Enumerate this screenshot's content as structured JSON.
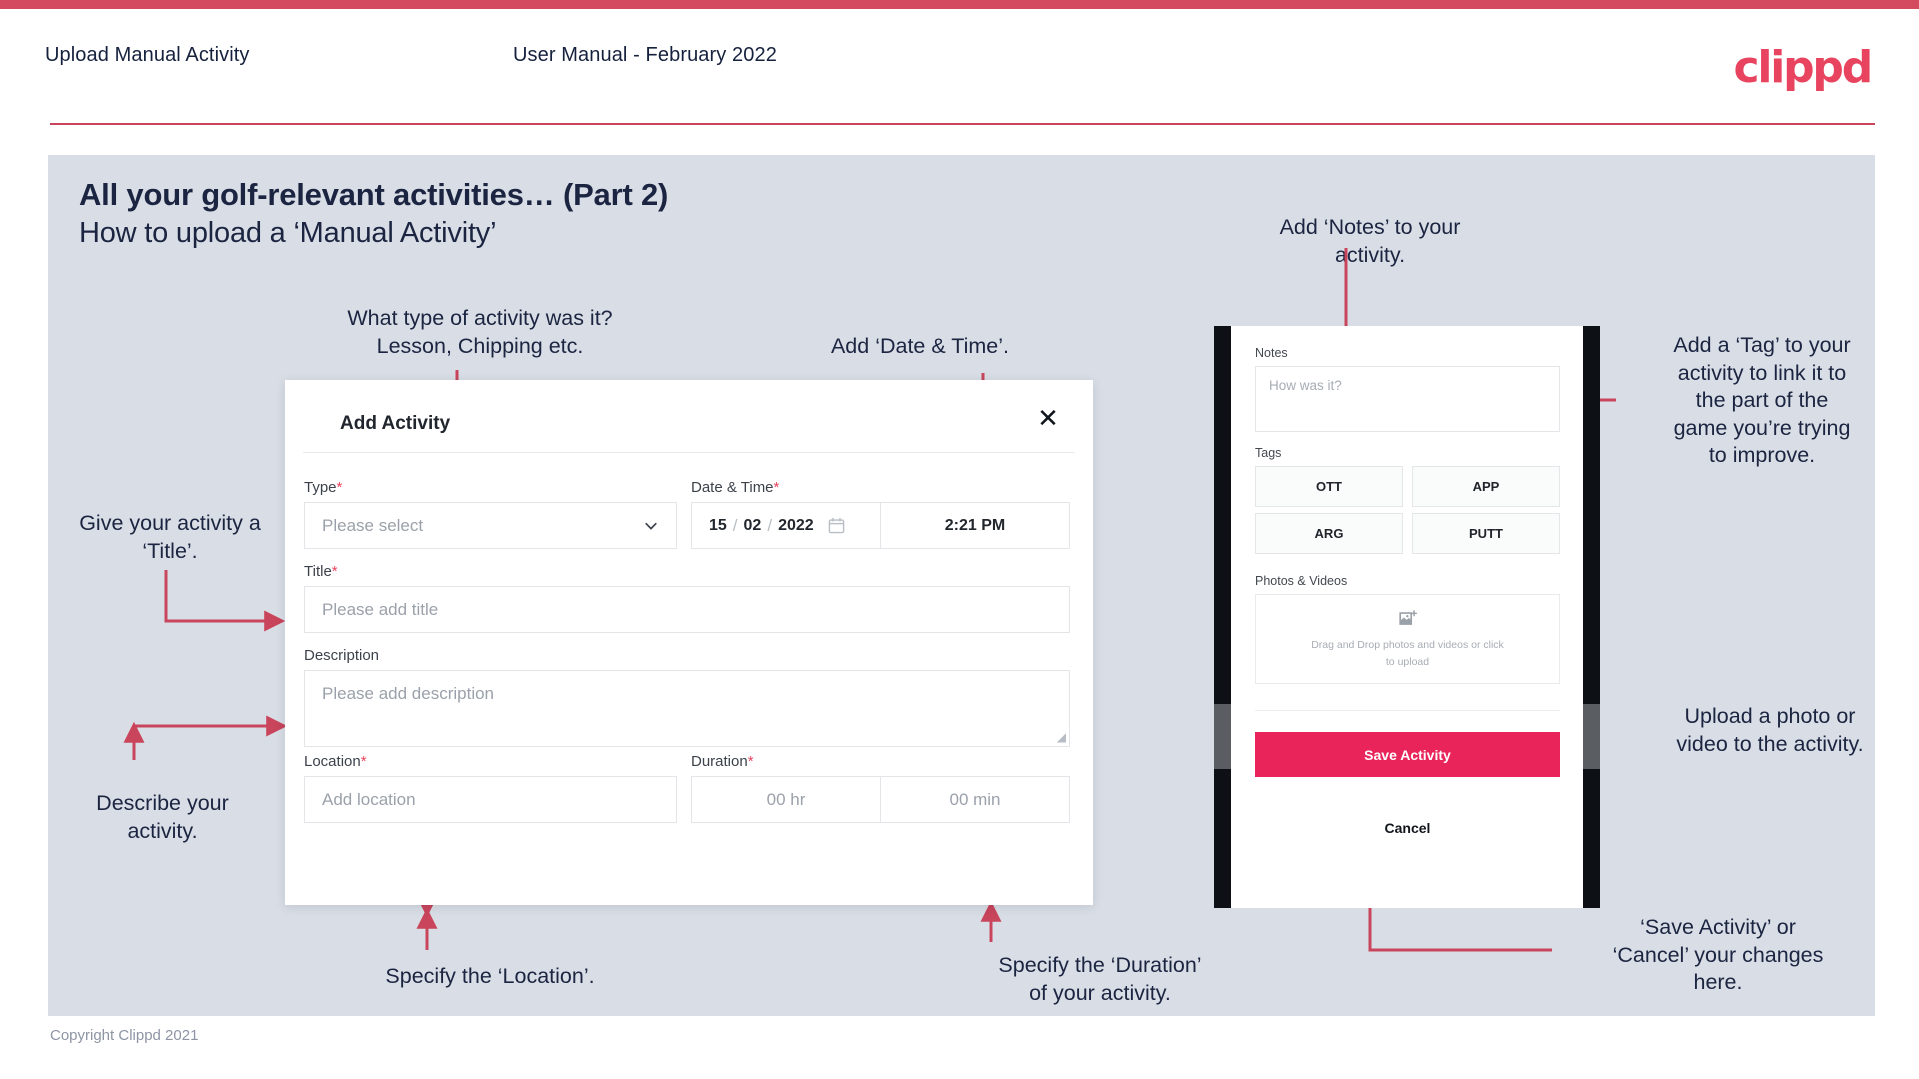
{
  "header": {
    "title": "Upload Manual Activity",
    "subtitle": "User Manual - February 2022",
    "logo": "clippd"
  },
  "slide": {
    "heading": "All your golf-relevant activities… (Part 2)",
    "subheading": "How to upload a ‘Manual Activity’",
    "copyright": "Copyright Clippd 2021"
  },
  "annotations": {
    "type": "What type of activity was it?\nLesson, Chipping etc.",
    "datetime": "Add ‘Date & Time’.",
    "title": "Give your activity a\n‘Title’.",
    "description": "Describe your\nactivity.",
    "location": "Specify the ‘Location’.",
    "duration": "Specify the ‘Duration’\nof your activity.",
    "notes": "Add ‘Notes’ to your\nactivity.",
    "tags": "Add a ‘Tag’ to your\nactivity to link it to\nthe part of the\ngame you’re trying\nto improve.",
    "upload": "Upload a photo or\nvideo to the activity.",
    "save": "‘Save Activity’ or\n‘Cancel’ your changes\nhere."
  },
  "modal": {
    "title": "Add Activity",
    "close_icon": "close-icon",
    "fields": {
      "type": {
        "label": "Type",
        "required": "*",
        "placeholder": "Please select"
      },
      "datetime": {
        "label": "Date & Time",
        "required": "*",
        "day": "15",
        "sep1": "/",
        "month": "02",
        "sep2": "/",
        "year": "2022",
        "time": "2:21 PM"
      },
      "title": {
        "label": "Title",
        "required": "*",
        "placeholder": "Please add title"
      },
      "description": {
        "label": "Description",
        "placeholder": "Please add description"
      },
      "location": {
        "label": "Location",
        "required": "*",
        "placeholder": "Add location"
      },
      "duration": {
        "label": "Duration",
        "required": "*",
        "hours": "00 hr",
        "minutes": "00 min"
      }
    }
  },
  "phone": {
    "notes_label": "Notes",
    "notes_placeholder": "How was it?",
    "tags_label": "Tags",
    "tags": [
      "OTT",
      "APP",
      "ARG",
      "PUTT"
    ],
    "photos_label": "Photos & Videos",
    "dropzone_text": "Drag and Drop photos and videos or click to upload",
    "dropzone_icon": "image-add-icon",
    "save_label": "Save Activity",
    "cancel_label": "Cancel"
  },
  "colors": {
    "brand_pink": "#e8445f",
    "save_pink": "#e8245a",
    "slide_bg": "#d9dee6",
    "ink": "#1b2440"
  }
}
